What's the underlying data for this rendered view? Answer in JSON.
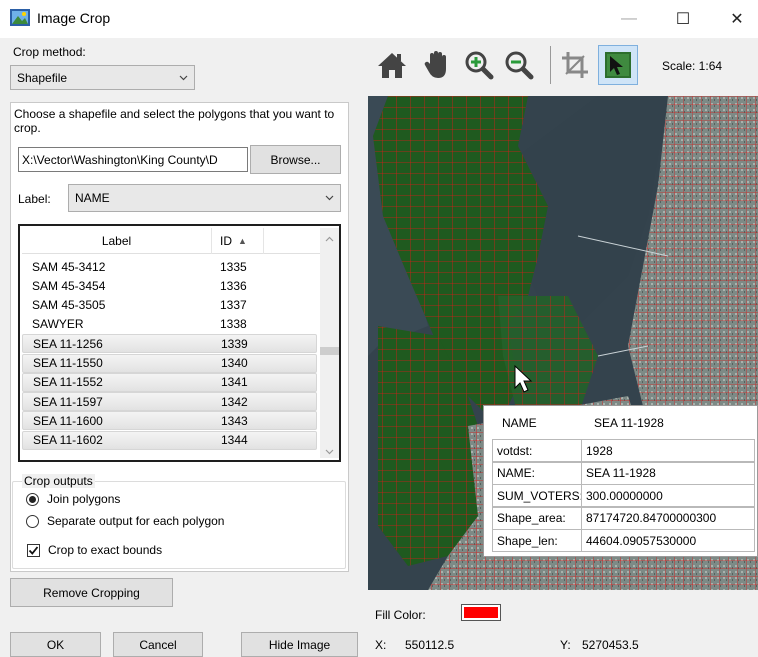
{
  "window": {
    "title": "Image Crop",
    "controls": {
      "minimize": "—",
      "maximize": "☐",
      "close": "✕"
    }
  },
  "crop_method": {
    "label": "Crop method:",
    "value": "Shapefile"
  },
  "shapefile": {
    "instructions": "Choose a shapefile and select the polygons that you want to crop.",
    "path": "X:\\Vector\\Washington\\King County\\D",
    "browse_label": "Browse...",
    "label_caption": "Label:",
    "label_field": "NAME"
  },
  "polygon_list": {
    "columns": [
      "Label",
      "ID"
    ],
    "sort_indicator": "▲",
    "rows": [
      {
        "label": "SAM 45-3412",
        "id": "1335",
        "selected": false
      },
      {
        "label": "SAM 45-3454",
        "id": "1336",
        "selected": false
      },
      {
        "label": "SAM 45-3505",
        "id": "1337",
        "selected": false
      },
      {
        "label": "SAWYER",
        "id": "1338",
        "selected": false
      },
      {
        "label": "SEA 11-1256",
        "id": "1339",
        "selected": true
      },
      {
        "label": "SEA 11-1550",
        "id": "1340",
        "selected": true
      },
      {
        "label": "SEA 11-1552",
        "id": "1341",
        "selected": true
      },
      {
        "label": "SEA 11-1597",
        "id": "1342",
        "selected": true
      },
      {
        "label": "SEA 11-1600",
        "id": "1343",
        "selected": true
      },
      {
        "label": "SEA 11-1602",
        "id": "1344",
        "selected": true
      }
    ]
  },
  "crop_outputs": {
    "title": "Crop outputs",
    "options": [
      {
        "label": "Join polygons",
        "checked": true
      },
      {
        "label": "Separate output for each polygon",
        "checked": false
      }
    ],
    "exact_bounds": {
      "label": "Crop to exact bounds",
      "checked": true
    }
  },
  "buttons": {
    "remove_cropping": "Remove Cropping",
    "ok": "OK",
    "cancel": "Cancel",
    "hide_image": "Hide Image"
  },
  "toolbar": {
    "icons": [
      "home-icon",
      "pan-hand-icon",
      "zoom-in-icon",
      "zoom-out-icon",
      "crop-icon",
      "select-polygon-icon"
    ],
    "scale": "Scale: 1:64"
  },
  "attributes": {
    "header": {
      "key": "NAME",
      "value": "SEA 11-1928"
    },
    "rows": [
      {
        "key": "votdst:",
        "value": "1928"
      },
      {
        "key": "NAME:",
        "value": "SEA 11-1928"
      },
      {
        "key": "SUM_VOTERS:",
        "value": "300.00000000"
      },
      {
        "key": "Shape_area:",
        "value": "87174720.84700000300"
      },
      {
        "key": "Shape_len:",
        "value": "44604.09057530000"
      }
    ]
  },
  "fill": {
    "label": "Fill Color:",
    "color": "#ff0000"
  },
  "coordinates": {
    "x_label": "X:",
    "x_value": "550112.5",
    "y_label": "Y:",
    "y_value": "5270453.5"
  }
}
